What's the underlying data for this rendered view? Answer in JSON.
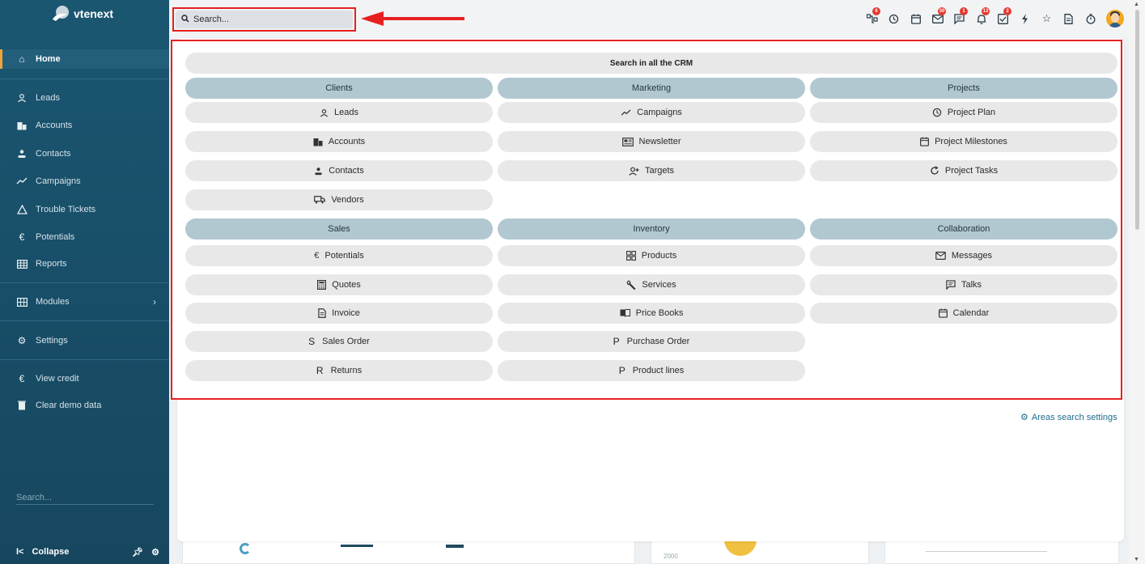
{
  "app": {
    "brand": "vtenext",
    "accent": "#f0a33a",
    "highlight": "#e62020"
  },
  "sidebar": {
    "home": "Home",
    "items": [
      {
        "label": "Leads",
        "icon": "user-icon"
      },
      {
        "label": "Accounts",
        "icon": "building-icon"
      },
      {
        "label": "Contacts",
        "icon": "person-icon"
      },
      {
        "label": "Campaigns",
        "icon": "trend-icon"
      },
      {
        "label": "Trouble Tickets",
        "icon": "warning-icon"
      },
      {
        "label": "Potentials",
        "icon": "euro-icon"
      },
      {
        "label": "Reports",
        "icon": "table-icon"
      }
    ],
    "modules": "Modules",
    "settings": "Settings",
    "view_credit": "View credit",
    "clear_demo": "Clear demo data",
    "search_placeholder": "Search...",
    "collapse": "Collapse"
  },
  "topbar": {
    "search_placeholder": "Search...",
    "icons": [
      {
        "name": "sitemap-icon",
        "badge": "6"
      },
      {
        "name": "history-icon",
        "badge": ""
      },
      {
        "name": "calendar-icon",
        "badge": ""
      },
      {
        "name": "mail-icon",
        "badge": "30"
      },
      {
        "name": "chat-icon",
        "badge": "1"
      },
      {
        "name": "bell-icon",
        "badge": "13"
      },
      {
        "name": "checkbox-icon",
        "badge": "2"
      },
      {
        "name": "bolt-icon",
        "badge": ""
      },
      {
        "name": "star-icon",
        "badge": ""
      },
      {
        "name": "document-icon",
        "badge": ""
      },
      {
        "name": "timer-icon",
        "badge": ""
      }
    ]
  },
  "panel": {
    "search_all": "Search in all the CRM",
    "columns": [
      {
        "header": "Clients",
        "items": [
          "Leads",
          "Accounts",
          "Contacts",
          "Vendors"
        ]
      },
      {
        "header": "Marketing",
        "items": [
          "Campaigns",
          "Newsletter",
          "Targets"
        ]
      },
      {
        "header": "Projects",
        "items": [
          "Project Plan",
          "Project Milestones",
          "Project Tasks"
        ]
      }
    ],
    "columns2": [
      {
        "header": "Sales",
        "items": [
          "Potentials",
          "Quotes",
          "Invoice",
          "Sales Order",
          "Returns"
        ],
        "letters": [
          "",
          "",
          "",
          "S",
          "R"
        ]
      },
      {
        "header": "Inventory",
        "items": [
          "Products",
          "Services",
          "Price Books",
          "Purchase Order",
          "Product lines"
        ],
        "letters": [
          "",
          "",
          "",
          "P",
          "P"
        ]
      },
      {
        "header": "Collaboration",
        "items": [
          "Messages",
          "Talks",
          "Calendar"
        ]
      }
    ]
  },
  "areas_settings": "Areas search settings",
  "bg_chart_tick": "2000"
}
